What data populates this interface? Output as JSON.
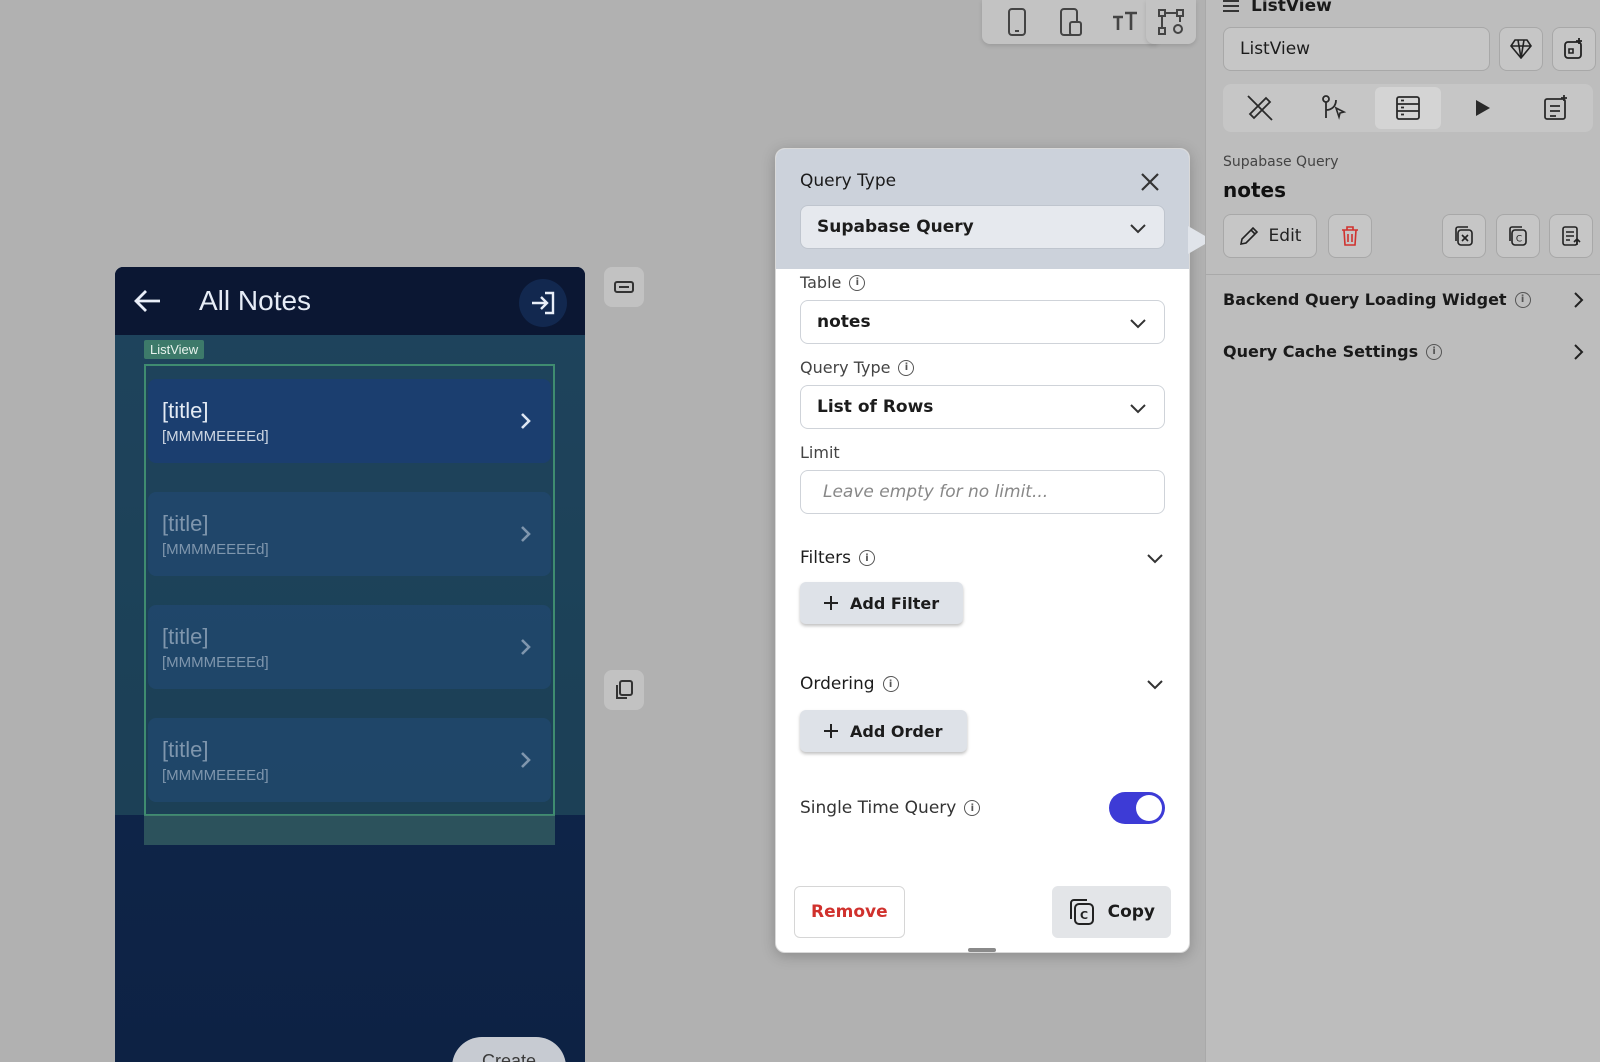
{
  "phone": {
    "appbar_title": "All Notes",
    "listview_badge": "ListView",
    "notes": [
      {
        "title": "[title]",
        "date": "[MMMMEEEEd]"
      },
      {
        "title": "[title]",
        "date": "[MMMMEEEEd]"
      },
      {
        "title": "[title]",
        "date": "[MMMMEEEEd]"
      },
      {
        "title": "[title]",
        "date": "[MMMMEEEEd]"
      }
    ],
    "create_label": "Create"
  },
  "popover": {
    "header_label": "Query Type",
    "query_type_value": "Supabase Query",
    "table_label": "Table",
    "table_value": "notes",
    "query_type2_label": "Query Type",
    "query_type2_value": "List of Rows",
    "limit_label": "Limit",
    "limit_placeholder": "Leave empty for no limit...",
    "filters_label": "Filters",
    "add_filter_label": "Add Filter",
    "ordering_label": "Ordering",
    "add_order_label": "Add Order",
    "single_time_label": "Single Time Query",
    "single_time_on": true,
    "remove_label": "Remove",
    "copy_label": "Copy"
  },
  "panel": {
    "title": "ListView",
    "name_value": "ListView",
    "subtitle": "Supabase Query",
    "query_name": "notes",
    "edit_label": "Edit",
    "row1": "Backend Query Loading Widget",
    "row2": "Query Cache Settings"
  },
  "colors": {
    "accent_toggle": "#3d3bd6",
    "remove_red": "#d0312d",
    "appbar": "#0b1733"
  }
}
